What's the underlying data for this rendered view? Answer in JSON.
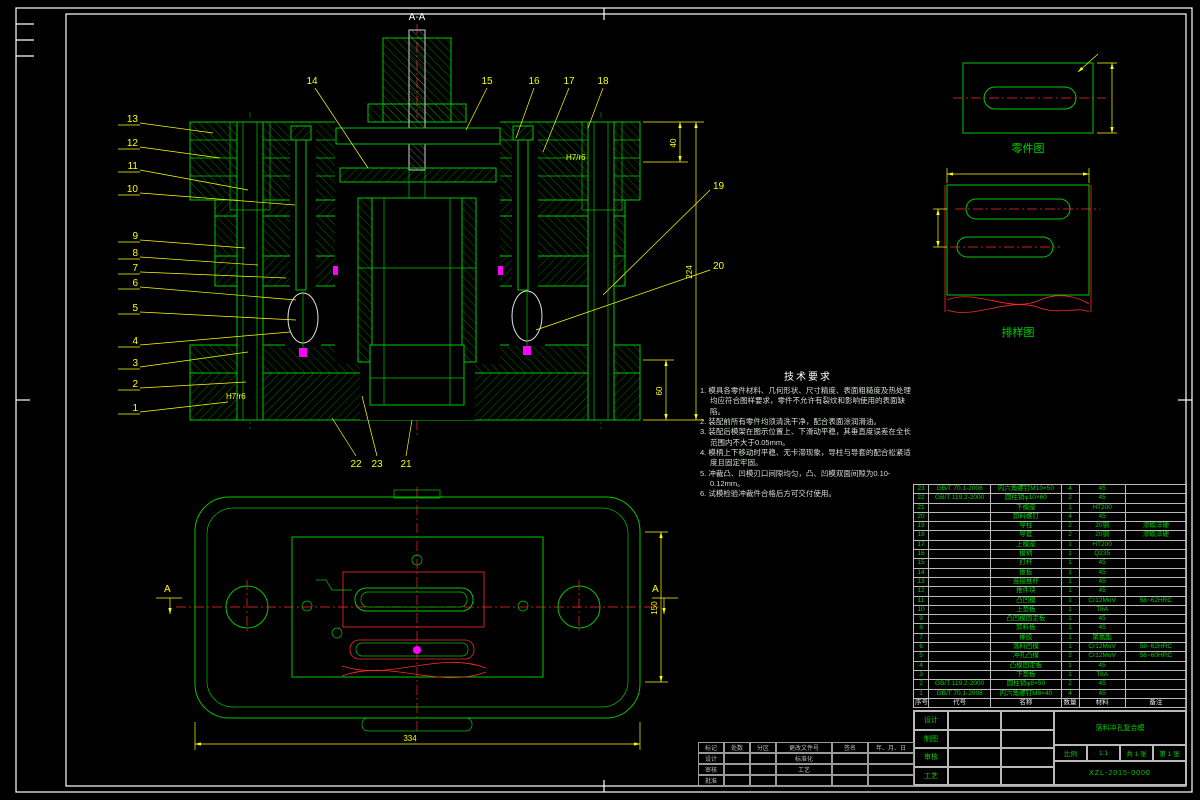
{
  "colors": {
    "green": "#00c800",
    "yellow": "#ffff00",
    "red": "#ff2a2a",
    "white": "#ffffff",
    "magenta": "#ff00ff"
  },
  "section": {
    "title": "A-A",
    "balloons_left": [
      "13",
      "12",
      "11",
      "10",
      "9",
      "8",
      "7",
      "6",
      "5",
      "4",
      "3",
      "2",
      "1"
    ],
    "balloons_top": [
      "14",
      "15",
      "16",
      "17",
      "18"
    ],
    "balloons_right": [
      "19",
      "20"
    ],
    "balloons_bottom": [
      "22",
      "23",
      "21"
    ],
    "dim_top": "40",
    "dim_overall": "224",
    "dim_bottom": "60",
    "fit_upper": "H7/r6",
    "fit_lower": "H7/r6"
  },
  "plan": {
    "dim_width": "334",
    "dim_height": "150",
    "section_letter_left": "A",
    "section_letter_right": "A"
  },
  "details": {
    "part_view_label": "零件图",
    "strip_view_label": "排样图"
  },
  "tech": {
    "title": "技术要求",
    "items": [
      "1. 模具各零件材料、几何形状、尺寸精度、表面粗糙度及热处理均应符合图样要求，零件不允许有裂纹和影响使用的表面缺陷。",
      "2. 装配前所有零件均须清洗干净，配合表面涂润滑油。",
      "3. 装配后模架在图示位置上、下滑动平稳，其垂直度误差在全长范围内不大于0.05mm。",
      "4. 模柄上下移动时平稳、无卡滞现象，导柱与导套的配合松紧适度且固定牢固。",
      "5. 冲裁凸、凹模刃口间隙均匀，凸、凹模双面间隙为0.10-0.12mm。",
      "6. 试模检验冲裁件合格后方可交付使用。"
    ]
  },
  "bom": {
    "headers": [
      "序号",
      "代号",
      "名称",
      "数量",
      "材料",
      "备注"
    ],
    "rows": [
      [
        "23",
        "GB/T 70.1-2008",
        "内六角螺钉M10×50",
        "4",
        "45",
        ""
      ],
      [
        "22",
        "GB/T 119.2-2000",
        "圆柱销φ10×60",
        "2",
        "45",
        ""
      ],
      [
        "21",
        "",
        "下模座",
        "1",
        "HT200",
        ""
      ],
      [
        "20",
        "",
        "卸料螺钉",
        "4",
        "45",
        ""
      ],
      [
        "19",
        "",
        "导柱",
        "2",
        "20钢",
        "渗碳淬硬"
      ],
      [
        "18",
        "",
        "导套",
        "2",
        "20钢",
        "渗碳淬硬"
      ],
      [
        "17",
        "",
        "上模座",
        "1",
        "HT200",
        ""
      ],
      [
        "16",
        "",
        "模柄",
        "1",
        "Q235",
        ""
      ],
      [
        "15",
        "",
        "打杆",
        "1",
        "45",
        ""
      ],
      [
        "14",
        "",
        "推板",
        "1",
        "45",
        ""
      ],
      [
        "13",
        "",
        "连接推杆",
        "1",
        "45",
        ""
      ],
      [
        "12",
        "",
        "推件块",
        "1",
        "45",
        ""
      ],
      [
        "11",
        "",
        "凸凹模",
        "1",
        "Cr12MoV",
        "58~62HRC"
      ],
      [
        "10",
        "",
        "上垫板",
        "1",
        "T8A",
        ""
      ],
      [
        "9",
        "",
        "凸凹模固定板",
        "1",
        "45",
        ""
      ],
      [
        "8",
        "",
        "卸料板",
        "1",
        "45",
        ""
      ],
      [
        "7",
        "",
        "橡胶",
        "1",
        "聚氨酯",
        ""
      ],
      [
        "6",
        "",
        "落料凹模",
        "1",
        "Cr12MoV",
        "58~62HRC"
      ],
      [
        "5",
        "",
        "冲孔凸模",
        "2",
        "Cr12MoV",
        "56~60HRC"
      ],
      [
        "4",
        "",
        "凸模固定板",
        "1",
        "45",
        ""
      ],
      [
        "3",
        "",
        "下垫板",
        "1",
        "T8A",
        ""
      ],
      [
        "2",
        "GB/T 119.2-2000",
        "圆柱销φ8×50",
        "2",
        "45",
        ""
      ],
      [
        "1",
        "GB/T 70.1-2008",
        "内六角螺钉M8×40",
        "4",
        "45",
        ""
      ]
    ]
  },
  "title_block": {
    "name": "落料冲孔复合模",
    "drawing_no": "XZL-2015-0000",
    "info_cells": [
      "比例",
      "1:1",
      "共 1 张",
      "第 1 张"
    ],
    "role_rows": [
      "设计",
      "制图",
      "审核",
      "工艺"
    ],
    "revision_headers": [
      "标记",
      "处数",
      "分区",
      "更改文件号",
      "签名",
      "年、月、日"
    ],
    "revision_rows": [
      [
        "设计",
        "",
        "",
        "标准化",
        "",
        ""
      ],
      [
        "审核",
        "",
        "",
        "工艺",
        "",
        ""
      ],
      [
        "批准",
        "",
        "",
        "",
        "",
        ""
      ]
    ]
  }
}
